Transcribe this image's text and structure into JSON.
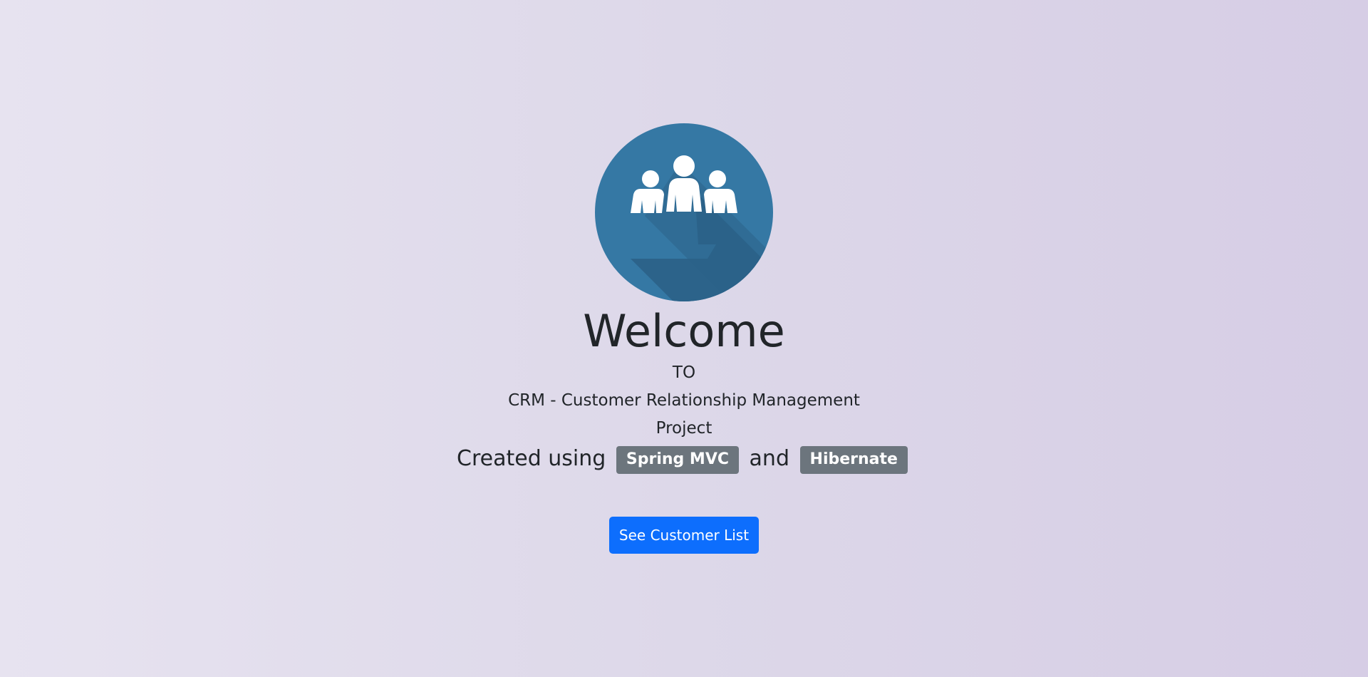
{
  "logo": {
    "icon": "crm-people-logo-icon",
    "text": "CRM",
    "circle_color": "#3578a4",
    "shadow_color": "#2c6289"
  },
  "heading": {
    "title": "Welcome",
    "to": "TO",
    "subtitle": "CRM - Customer Relationship Management",
    "project": "Project"
  },
  "created": {
    "prefix": "Created using",
    "badge1": "Spring MVC",
    "joiner": "and",
    "badge2": "Hibernate"
  },
  "actions": {
    "customer_list_label": "See Customer List",
    "button_color": "#0d6efd"
  }
}
